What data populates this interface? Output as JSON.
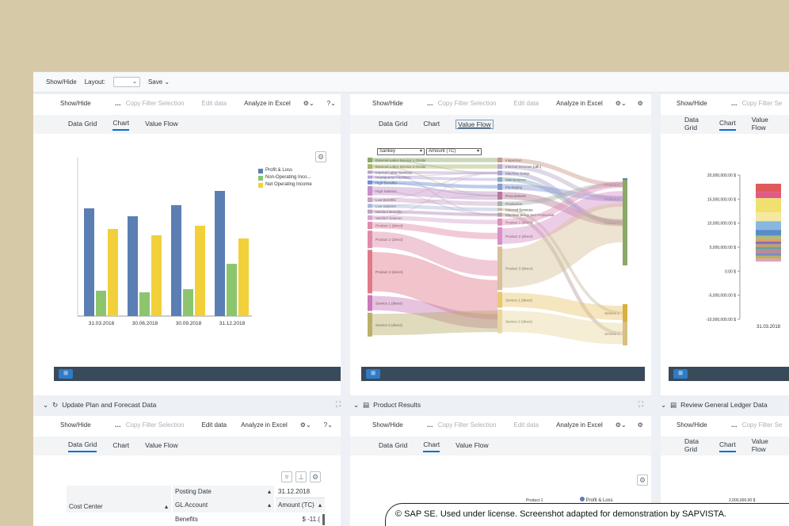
{
  "topbar": {
    "show_hide": "Show/Hide",
    "layout_label": "Layout:",
    "save_label": "Save"
  },
  "toolbar": {
    "show_hide": "Show/Hide",
    "copy_filter": "Copy Filter Selection",
    "edit_data": "Edit data",
    "analyze": "Analyze in Excel",
    "copy_filter_short": "Copy Filter Se"
  },
  "tabs": {
    "data_grid": "Data Grid",
    "chart": "Chart",
    "value_flow": "Value Flow"
  },
  "panel1": {
    "chart_data": {
      "type": "bar",
      "categories": [
        "31.03.2018",
        "30.06.2018",
        "30.09.2018",
        "31.12.2018"
      ],
      "series": [
        {
          "name": "Profit & Loss",
          "color": "#5b7fb3",
          "values": [
            68,
            63,
            70,
            79
          ]
        },
        {
          "name": "Non-Operating Inco...",
          "color": "#8cc56e",
          "values": [
            16,
            15,
            17,
            33
          ]
        },
        {
          "name": "Net Operating Income",
          "color": "#f2d03a",
          "values": [
            55,
            51,
            57,
            49
          ]
        }
      ]
    }
  },
  "panel2": {
    "select1": "Sankey",
    "select2": "Amount (TC)",
    "sources": [
      "External Labor Service 1 Onsite",
      "External Labor Service 2 Onsite",
      "Internal Labor Services",
      "Headquarter Facilities",
      "High Benefits",
      "High Salaries",
      "Low Benefits",
      "Low Salaries",
      "Medium Benefits",
      "Medium Salaries",
      "Product 1 (direct)",
      "Product 2 (direct)",
      "Product 3 (direct)",
      "Service 1 (direct)",
      "Service 2 (direct)"
    ],
    "middles": [
      "Inspection",
      "Internal Services (oth.)",
      "Machine Setup",
      "Maintenance",
      "Packaging",
      "Procurement",
      "Production",
      "Material Services",
      "Machine Setup and Production",
      "Product 1 (direct)",
      "Product 2 (direct)",
      "Product 3 (direct)",
      "Service 1 (direct)",
      "Service 2 (direct)"
    ],
    "targets": [
      "Product 1",
      "Product 2",
      "Product 3",
      "Service 1",
      "Service 2"
    ]
  },
  "panel3": {
    "chart_data": {
      "type": "bar",
      "categories": [
        "31.03.2018"
      ],
      "y_ticks": [
        "20,000,000.00 $",
        "15,000,000.00 $",
        "10,000,000.00 $",
        "5,000,000.00 $",
        "0.00 $",
        "-5,000,000.00 $",
        "-10,000,000.00 $"
      ],
      "ylim": [
        -10000000,
        20000000
      ]
    }
  },
  "sections": {
    "update_plan": "Update Plan and Forecast Data",
    "product_results": "Product Results",
    "review_gl": "Review General Ledger Data"
  },
  "grid": {
    "posting_date": "Posting Date",
    "posting_value": "31.12.2018",
    "cost_center": "Cost Center",
    "gl_account": "GL Account",
    "amount": "Amount (TC)",
    "benefits": "Benefits",
    "benefit_value": "$ -11.("
  },
  "panel5": {
    "series_label": "Profit & Loss",
    "product": "Product 1"
  },
  "panel6": {
    "tick": "2,000,000.00 $"
  },
  "copyright": "© SAP SE. Used under license. Screenshot adapted for demonstration by SAPVISTA."
}
